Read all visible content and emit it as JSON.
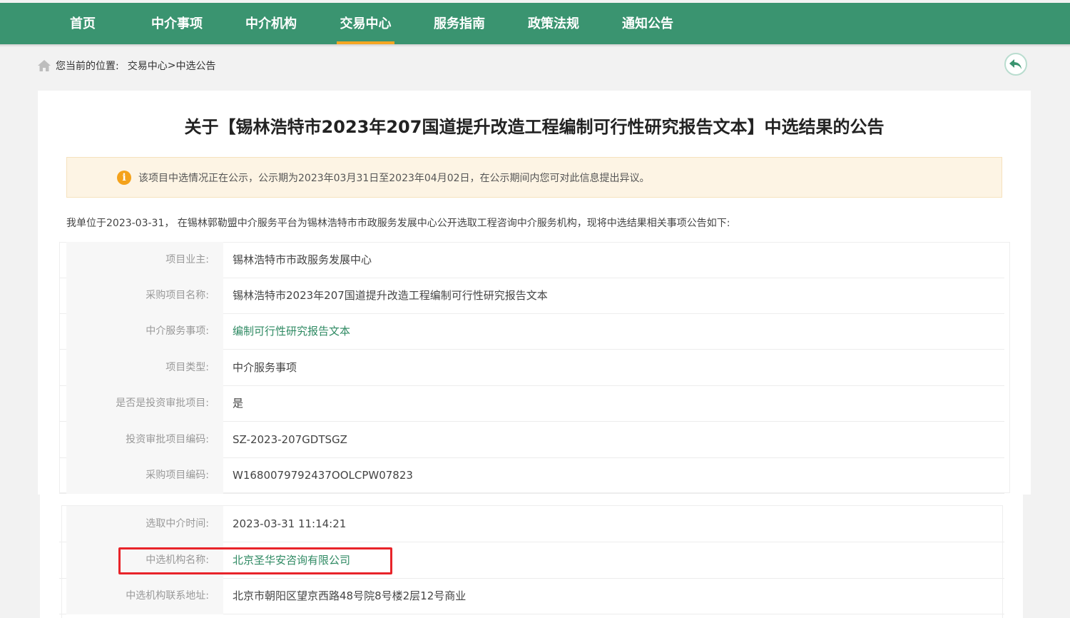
{
  "nav": {
    "items": [
      {
        "label": "首页"
      },
      {
        "label": "中介事项"
      },
      {
        "label": "中介机构"
      },
      {
        "label": "交易中心"
      },
      {
        "label": "服务指南"
      },
      {
        "label": "政策法规"
      },
      {
        "label": "通知公告"
      }
    ],
    "active_index": 3,
    "colors": {
      "background": "#3a9470",
      "active_underline": "#f5a623"
    }
  },
  "breadcrumb": {
    "prefix": "您当前的位置:",
    "level1": "交易中心",
    "separator": " >",
    "level2": "中选公告",
    "home_icon": "home-icon"
  },
  "back_button": {
    "icon": "back-arrow-icon"
  },
  "title": "关于【锡林浩特市2023年207国道提升改造工程编制可行性研究报告文本】中选结果的公告",
  "notice": {
    "icon": "info-icon",
    "icon_glyph": "i",
    "text": "该项目中选情况正在公示，公示期为2023年03月31日至2023年04月02日，在公示期间内您可对此信息提出异议。"
  },
  "intro": "我单位于2023-03-31， 在锡林郭勒盟中介服务平台为锡林浩特市市政服务发展中心公开选取工程咨询中介服务机构，现将中选结果相关事项公告如下:",
  "details": [
    {
      "label": "项目业主:",
      "value": "锡林浩特市市政服务发展中心"
    },
    {
      "label": "采购项目名称:",
      "value": "锡林浩特市2023年207国道提升改造工程编制可行性研究报告文本"
    },
    {
      "label": "中介服务事项:",
      "value": "编制可行性研究报告文本"
    },
    {
      "label": "项目类型:",
      "value": "中介服务事项"
    },
    {
      "label": "是否是投资审批项目:",
      "value": "是"
    },
    {
      "label": "投资审批项目编码:",
      "value": "SZ-2023-207GDTSGZ"
    },
    {
      "label": "采购项目编码:",
      "value": "W1680079792437OOLCPW07823"
    },
    {
      "label": "选取中介时间:",
      "value": "2023-03-31 11:14:21"
    },
    {
      "label": "中选机构名称:",
      "value": "北京圣华安咨询有限公司"
    },
    {
      "label": "中选机构联系地址:",
      "value": "北京市朝阳区望京西路48号院8号楼2层12号商业"
    }
  ],
  "colors": {
    "link_green": "#2f8a63",
    "highlight_red": "#e8242a",
    "notice_bg": "#fdf4e4",
    "notice_icon": "#f4a21b"
  }
}
